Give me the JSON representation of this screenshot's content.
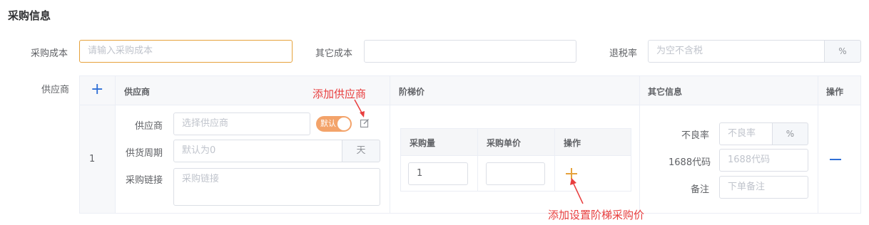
{
  "section_title": "采购信息",
  "purchase_cost": {
    "label": "采购成本",
    "placeholder": "请输入采购成本"
  },
  "other_cost": {
    "label": "其它成本",
    "value": ""
  },
  "tax_refund": {
    "label": "退税率",
    "placeholder": "为空不含税",
    "suffix": "%"
  },
  "supplier_label": "供应商",
  "table": {
    "headers": {
      "supplier": "供应商",
      "tiered_price": "阶梯价",
      "other_info": "其它信息",
      "action": "操作"
    },
    "row": {
      "index": "1",
      "supplier": {
        "label": "供应商",
        "placeholder": "选择供应商",
        "toggle_label": "默认"
      },
      "lead_time": {
        "label": "供货周期",
        "placeholder": "默认为0",
        "suffix": "天"
      },
      "purchase_link": {
        "label": "采购链接",
        "placeholder": "采购链接"
      },
      "tiered": {
        "headers": {
          "qty": "采购量",
          "unit_price": "采购单价",
          "action": "操作"
        },
        "qty_value": "1",
        "unit_price_value": ""
      },
      "other": {
        "defect_rate": {
          "label": "不良率",
          "placeholder": "不良率",
          "suffix": "%"
        },
        "code_1688": {
          "label": "1688代码",
          "placeholder": "1688代码"
        },
        "remark": {
          "label": "备注",
          "placeholder": "下单备注"
        }
      }
    }
  },
  "annotations": {
    "add_supplier": "添加供应商",
    "add_tiered_price": "添加设置阶梯采购价"
  },
  "colors": {
    "accent_orange": "#e6a23c",
    "toggle": "#f3a36a",
    "blue": "#2f6fd6",
    "annotation_red": "#e83e3e"
  }
}
